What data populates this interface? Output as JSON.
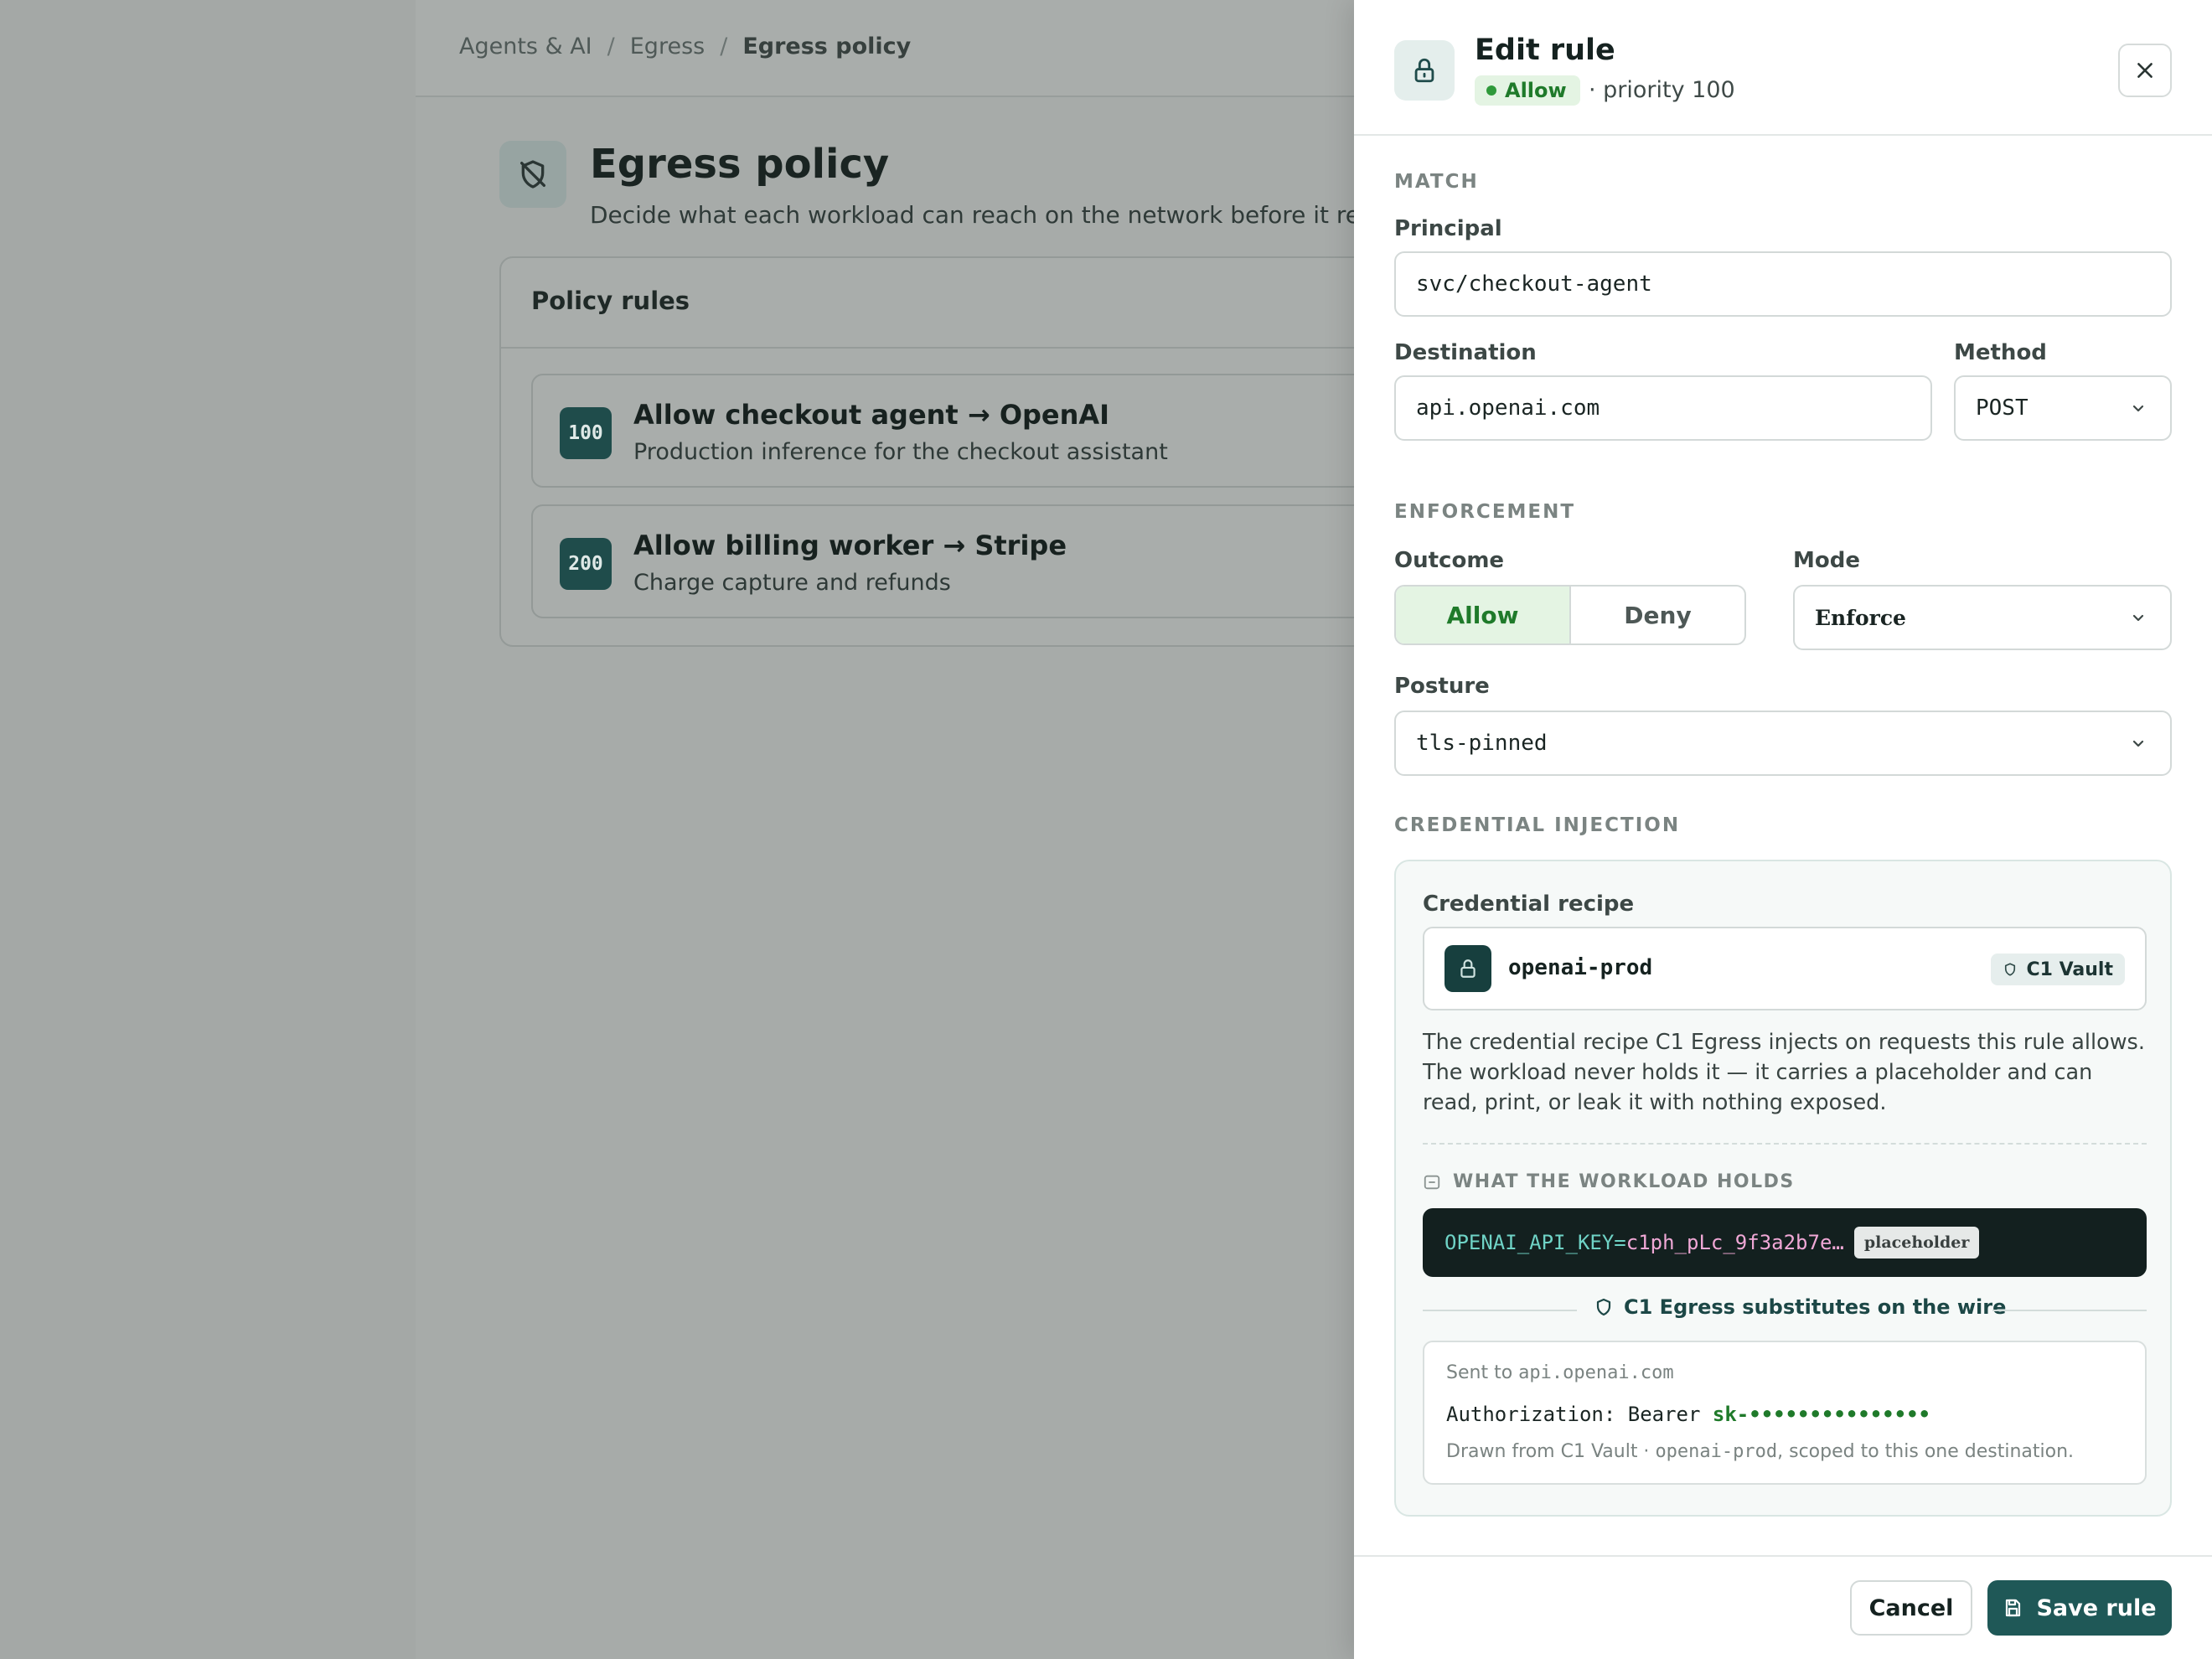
{
  "breadcrumb": [
    "Agents & AI",
    "Egress",
    "Egress policy"
  ],
  "page": {
    "title": "Egress policy",
    "subtitle": "Decide what each workload can reach on the network before it reache"
  },
  "rules_card": {
    "title": "Policy rules",
    "rules": [
      {
        "priority": "100",
        "title": "Allow checkout agent → OpenAI",
        "description": "Production inference for the checkout assistant"
      },
      {
        "priority": "200",
        "title": "Allow billing worker → Stripe",
        "description": "Charge capture and refunds"
      }
    ]
  },
  "drawer": {
    "title": "Edit rule",
    "badge": "Allow",
    "priority_text": "· priority 100",
    "sections": {
      "match": "MATCH",
      "enforcement": "ENFORCEMENT",
      "credential": "CREDENTIAL INJECTION"
    },
    "fields": {
      "principal_label": "Principal",
      "principal_value": "svc/checkout-agent",
      "destination_label": "Destination",
      "destination_value": "api.openai.com",
      "method_label": "Method",
      "method_value": "POST",
      "outcome_label": "Outcome",
      "outcome_options": [
        "Allow",
        "Deny"
      ],
      "outcome_selected": "Allow",
      "mode_label": "Mode",
      "mode_value": "Enforce",
      "posture_label": "Posture",
      "posture_value": "tls-pinned"
    },
    "credential": {
      "recipe_label": "Credential recipe",
      "recipe_name": "openai-prod",
      "vault_badge": "C1 Vault",
      "description": "The credential recipe C1 Egress injects on requests this rule allows. The workload never holds it — it carries a placeholder and can read, print, or leak it with nothing exposed.",
      "holds_label": "WHAT THE WORKLOAD HOLDS",
      "env_key": "OPENAI_API_KEY=",
      "env_value": "c1ph_pLc_9f3a2b7e…",
      "placeholder_badge": "placeholder",
      "substitutes_label": "C1 Egress substitutes on the wire",
      "sent_to_prefix": "Sent to ",
      "sent_to_host": "api.openai.com",
      "auth_prefix": "Authorization: Bearer ",
      "auth_secret": "sk-•••••••••••••••",
      "drawn_prefix": "Drawn from C1 Vault · ",
      "drawn_recipe": "openai-prod",
      "drawn_suffix": ", scoped to this one destination."
    },
    "footer": {
      "cancel": "Cancel",
      "save": "Save rule"
    }
  },
  "colors": {
    "accent": "#1f5857",
    "allow_green": "#1f7a2a",
    "allow_bg": "#e4f4e3",
    "overlay": "#a6aaa8"
  },
  "icons": [
    "shield-off-icon",
    "lock-icon",
    "close-icon",
    "chevron-down-icon",
    "shield-icon",
    "placeholder-card-icon",
    "save-icon"
  ]
}
